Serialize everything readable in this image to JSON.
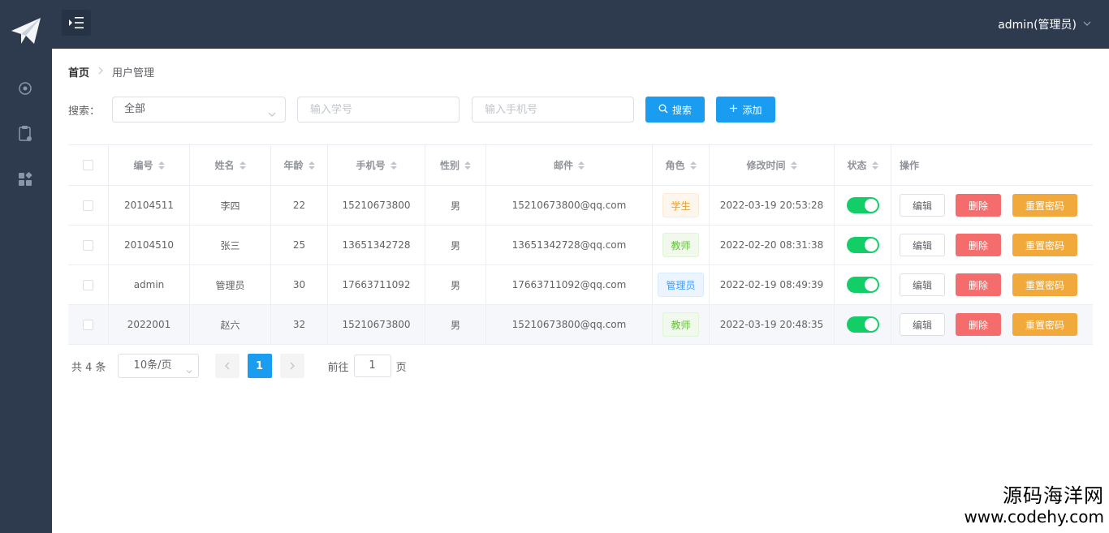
{
  "header": {
    "user_label": "admin(管理员)"
  },
  "breadcrumb": {
    "home": "首页",
    "current": "用户管理"
  },
  "search": {
    "label": "搜索：",
    "select_value": "全部",
    "student_id_placeholder": "输入学号",
    "phone_placeholder": "输入手机号",
    "search_button": "搜索",
    "add_button": "添加"
  },
  "table": {
    "columns": [
      "编号",
      "姓名",
      "年龄",
      "手机号",
      "性别",
      "邮件",
      "角色",
      "修改时间",
      "状态",
      "操作"
    ],
    "rows": [
      {
        "id": "20104511",
        "name": "李四",
        "age": "22",
        "phone": "15210673800",
        "gender": "男",
        "email": "15210673800@qq.com",
        "role": "学生",
        "role_type": "student",
        "modified": "2022-03-19 20:53:28",
        "enabled": true
      },
      {
        "id": "20104510",
        "name": "张三",
        "age": "25",
        "phone": "13651342728",
        "gender": "男",
        "email": "13651342728@qq.com",
        "role": "教师",
        "role_type": "teacher",
        "modified": "2022-02-20 08:31:38",
        "enabled": true
      },
      {
        "id": "admin",
        "name": "管理员",
        "age": "30",
        "phone": "17663711092",
        "gender": "男",
        "email": "17663711092@qq.com",
        "role": "管理员",
        "role_type": "admin",
        "modified": "2022-02-19 08:49:39",
        "enabled": true
      },
      {
        "id": "2022001",
        "name": "赵六",
        "age": "32",
        "phone": "15210673800",
        "gender": "男",
        "email": "15210673800@qq.com",
        "role": "教师",
        "role_type": "teacher",
        "modified": "2022-03-19 20:48:35",
        "enabled": true
      }
    ],
    "actions": {
      "edit": "编辑",
      "delete": "删除",
      "reset_password": "重置密码"
    }
  },
  "pagination": {
    "total": "共 4 条",
    "page_size": "10条/页",
    "current_page": "1",
    "goto_label": "前往",
    "goto_value": "1",
    "page_suffix": "页"
  },
  "watermark": {
    "line1": "源码海洋网",
    "line2": "www.codehy.com"
  },
  "colors": {
    "sidebar": "#2e3b4e",
    "primary": "#1a9cf0",
    "danger": "#f56c6c",
    "warning": "#f2a93b",
    "switch_on": "#13ce66"
  }
}
